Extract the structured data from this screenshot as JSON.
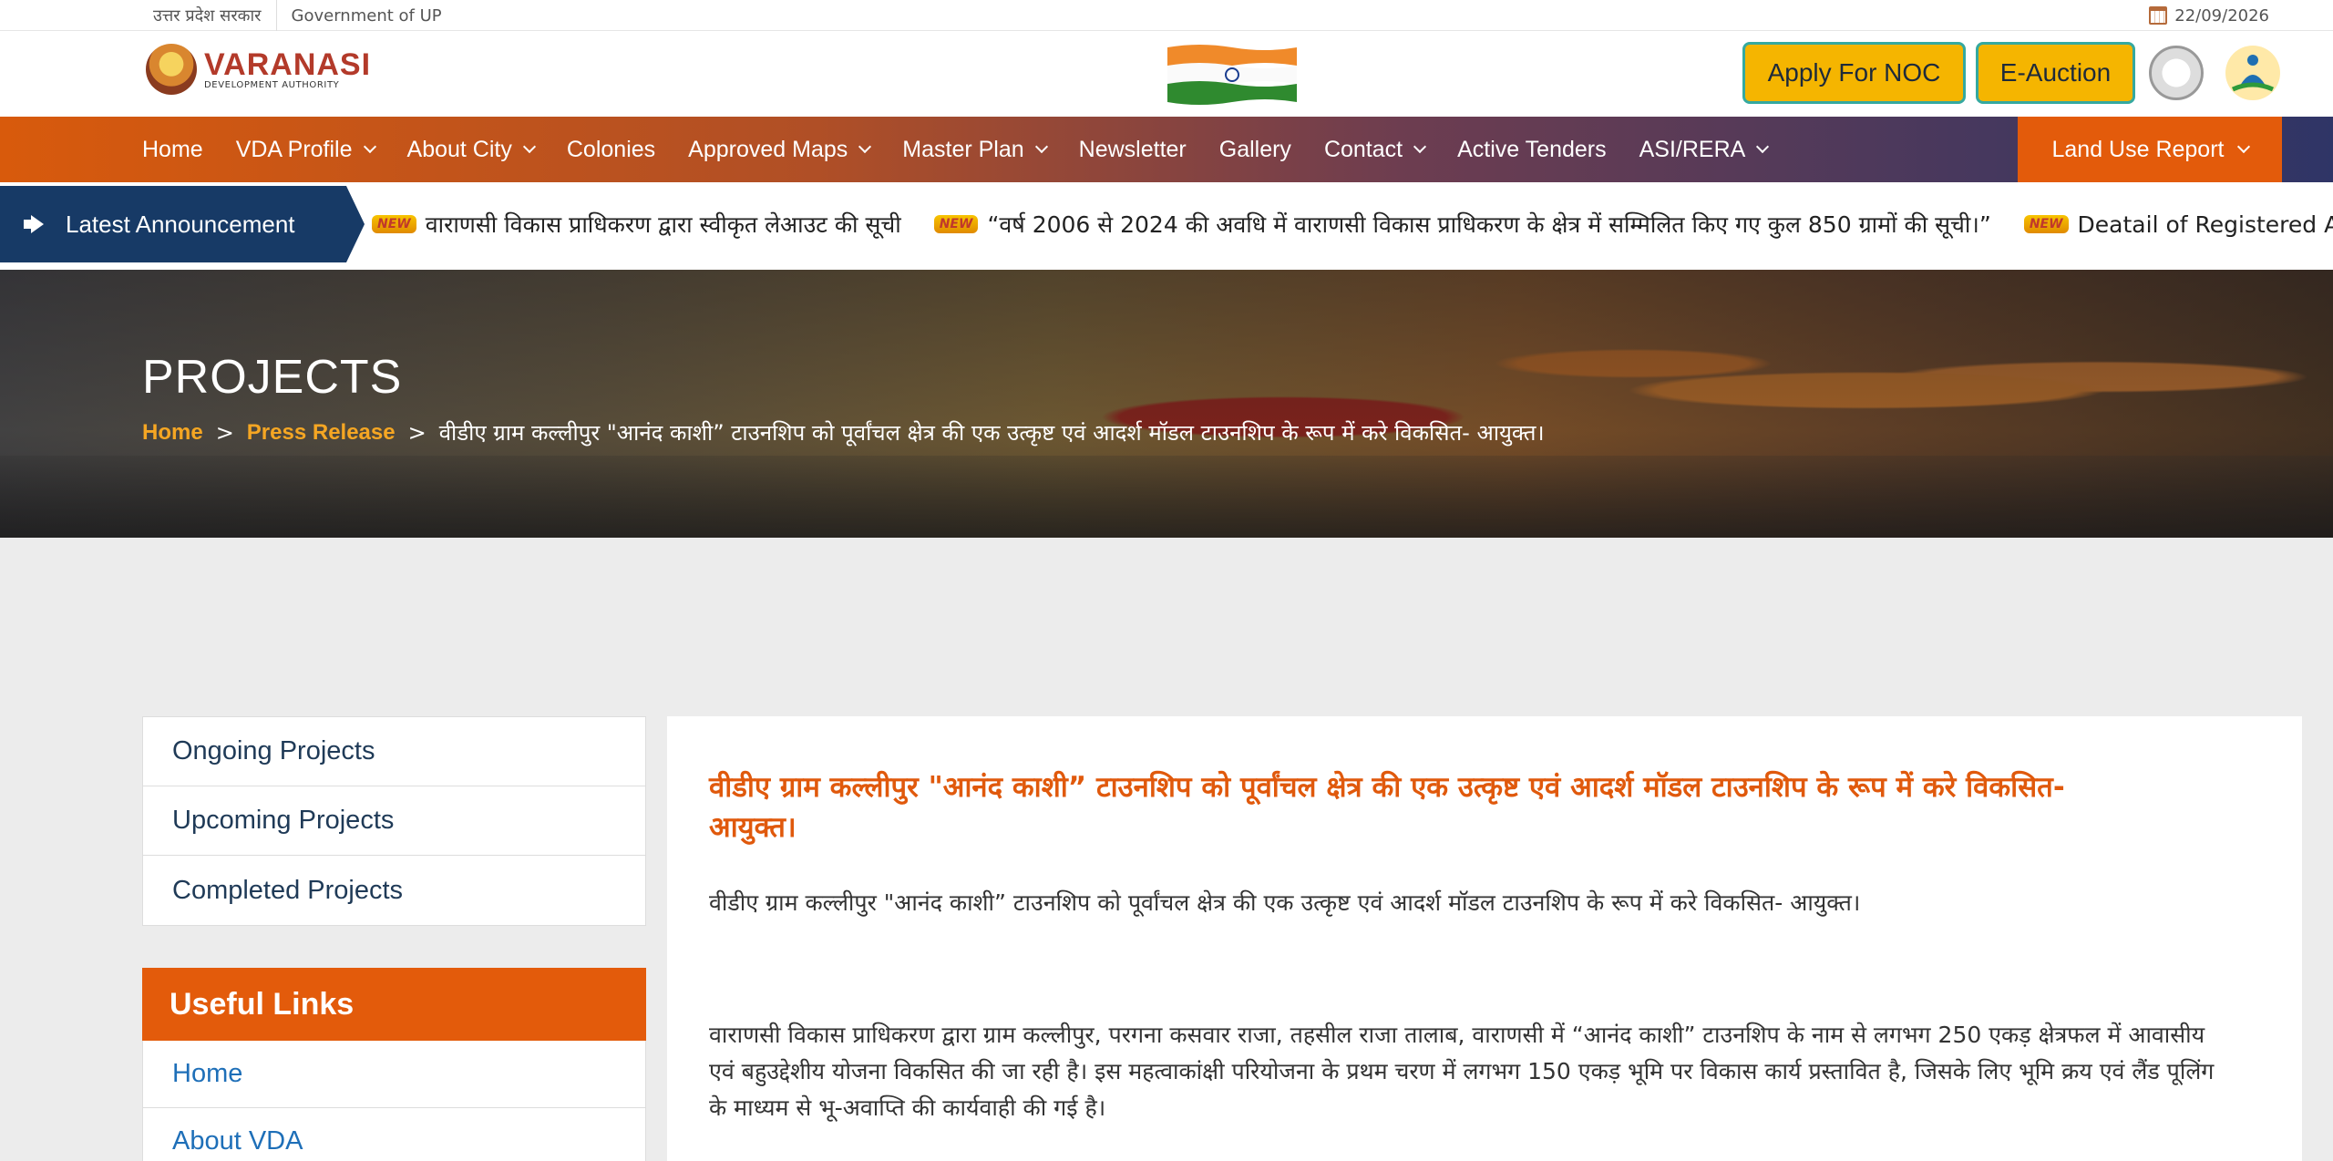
{
  "topstrip": {
    "state_hindi": "उत्तर प्रदेश सरकार",
    "government": "Government of UP",
    "date": "22/09/2026"
  },
  "header": {
    "logo_title": "VARANASI",
    "logo_subtitle": "DEVELOPMENT AUTHORITY",
    "apply_noc": "Apply For NOC",
    "e_auction": "E-Auction"
  },
  "nav": {
    "items": [
      {
        "label": "Home",
        "dropdown": false
      },
      {
        "label": "VDA Profile",
        "dropdown": true
      },
      {
        "label": "About City",
        "dropdown": true
      },
      {
        "label": "Colonies",
        "dropdown": false
      },
      {
        "label": "Approved Maps",
        "dropdown": true
      },
      {
        "label": "Master Plan",
        "dropdown": true
      },
      {
        "label": "Newsletter",
        "dropdown": false
      },
      {
        "label": "Gallery",
        "dropdown": false
      },
      {
        "label": "Contact",
        "dropdown": true
      },
      {
        "label": "Active Tenders",
        "dropdown": false
      },
      {
        "label": "ASI/RERA",
        "dropdown": true
      }
    ],
    "land_use": "Land Use Report"
  },
  "announcement": {
    "label": "Latest Announcement",
    "badge": "NEW",
    "items": [
      "वाराणसी विकास प्राधिकरण द्वारा स्वीकृत लेआउट की सूची",
      "“वर्ष 2006 से 2024 की अवधि में वाराणसी विकास प्राधिकरण के क्षेत्र में सम्मिलित किए गए कुल 850 ग्रामों की सूची।”",
      "Deatail of Registered Architects"
    ]
  },
  "hero": {
    "title": "PROJECTS",
    "crumb_home": "Home",
    "crumb_section": "Press Release",
    "crumb_current": "वीडीए ग्राम कल्लीपुर \"आनंद काशी” टाउनशिप को पूर्वांचल क्षेत्र की एक उत्कृष्ट एवं आदर्श मॉडल टाउनशिप के रूप में करे विकसित- आयुक्त।",
    "sep": ">"
  },
  "sidebar": {
    "projects": [
      "Ongoing Projects",
      "Upcoming Projects",
      "Completed Projects"
    ],
    "useful_title": "Useful Links",
    "useful_links": [
      "Home",
      "About VDA"
    ]
  },
  "content": {
    "title": "वीडीए ग्राम कल्लीपुर \"आनंद काशी” टाउनशिप को पूर्वांचल क्षेत्र की एक उत्कृष्ट एवं आदर्श मॉडल टाउनशिप के रूप में करे विकसित- आयुक्त।",
    "subtitle": "वीडीए ग्राम कल्लीपुर \"आनंद काशी” टाउनशिप को पूर्वांचल क्षेत्र की एक उत्कृष्ट एवं आदर्श मॉडल टाउनशिप के रूप में करे विकसित- आयुक्त।",
    "paragraph": "वाराणसी विकास प्राधिकरण द्वारा ग्राम कल्लीपुर, परगना कसवार राजा, तहसील राजा तालाब, वाराणसी में “आनंद काशी” टाउनशिप के नाम से लगभग 250 एकड़ क्षेत्रफल में आवासीय एवं बहुउद्देशीय योजना विकसित की जा रही है। इस महत्वाकांक्षी परियोजना के प्रथम चरण में लगभग 150 एकड़ भूमि पर विकास कार्य प्रस्तावित है, जिसके लिए भूमि क्रय एवं लैंड पूलिंग के माध्यम से भू-अवाप्ति की कार्यवाही की गई है।"
  },
  "colors": {
    "accent_orange": "#e35b0b",
    "announce_blue": "#173a66",
    "button_yellow": "#f5b500",
    "link_blue": "#1e6fb8"
  },
  "icons": {
    "calendar": "calendar-icon",
    "megaphone": "megaphone-icon",
    "flag": "india-flag-icon",
    "up_emblem": "up-emblem-icon",
    "yoga": "yoga-icon"
  }
}
